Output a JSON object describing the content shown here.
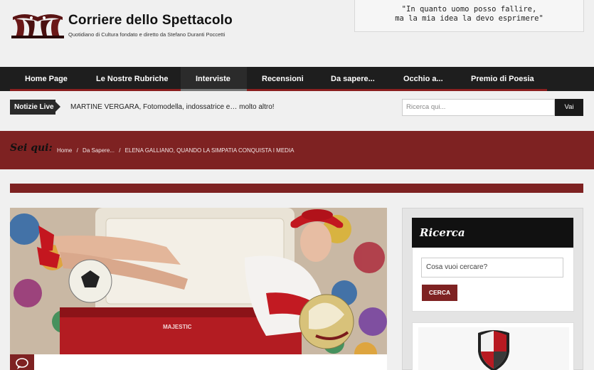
{
  "header": {
    "title": "Corriere dello Spettacolo",
    "subtitle": "Quotidiano di Cultura fondato e diretto da Stefano Duranti Poccetti",
    "quote_line1": "\"In quanto uomo posso fallire,",
    "quote_line2": "ma la mia idea la devo esprimere\""
  },
  "nav": {
    "items": [
      {
        "label": "Home Page"
      },
      {
        "label": "Le Nostre Rubriche"
      },
      {
        "label": "Interviste"
      },
      {
        "label": "Recensioni"
      },
      {
        "label": "Da sapere..."
      },
      {
        "label": "Occhio a..."
      },
      {
        "label": "Premio di Poesia"
      }
    ],
    "active_item": "Interviste"
  },
  "ticker": {
    "label": "Notizie Live",
    "text": "MARTINE VERGARA, Fotomodella, indossatrice e… molto altro!"
  },
  "top_search": {
    "placeholder": "Ricerca qui...",
    "button": "Vai"
  },
  "breadcrumb": {
    "label": "Sei qui:",
    "items": [
      "Home",
      "/",
      "Da Sapere...",
      "/",
      "ELENA GALLIANO, QUANDO LA SIMPATIA CONQUISTA I MEDIA"
    ]
  },
  "sidebar": {
    "search_widget": {
      "title": "Ricerca",
      "input_value": "Cosa vuoi cercare?",
      "button": "CERCA"
    }
  },
  "hero": {
    "cooler_brand": "MAJESTIC"
  },
  "colors": {
    "brand_red": "#7e2222",
    "nav_bg": "#1e1e1e",
    "page_bg": "#f0f0f0"
  }
}
